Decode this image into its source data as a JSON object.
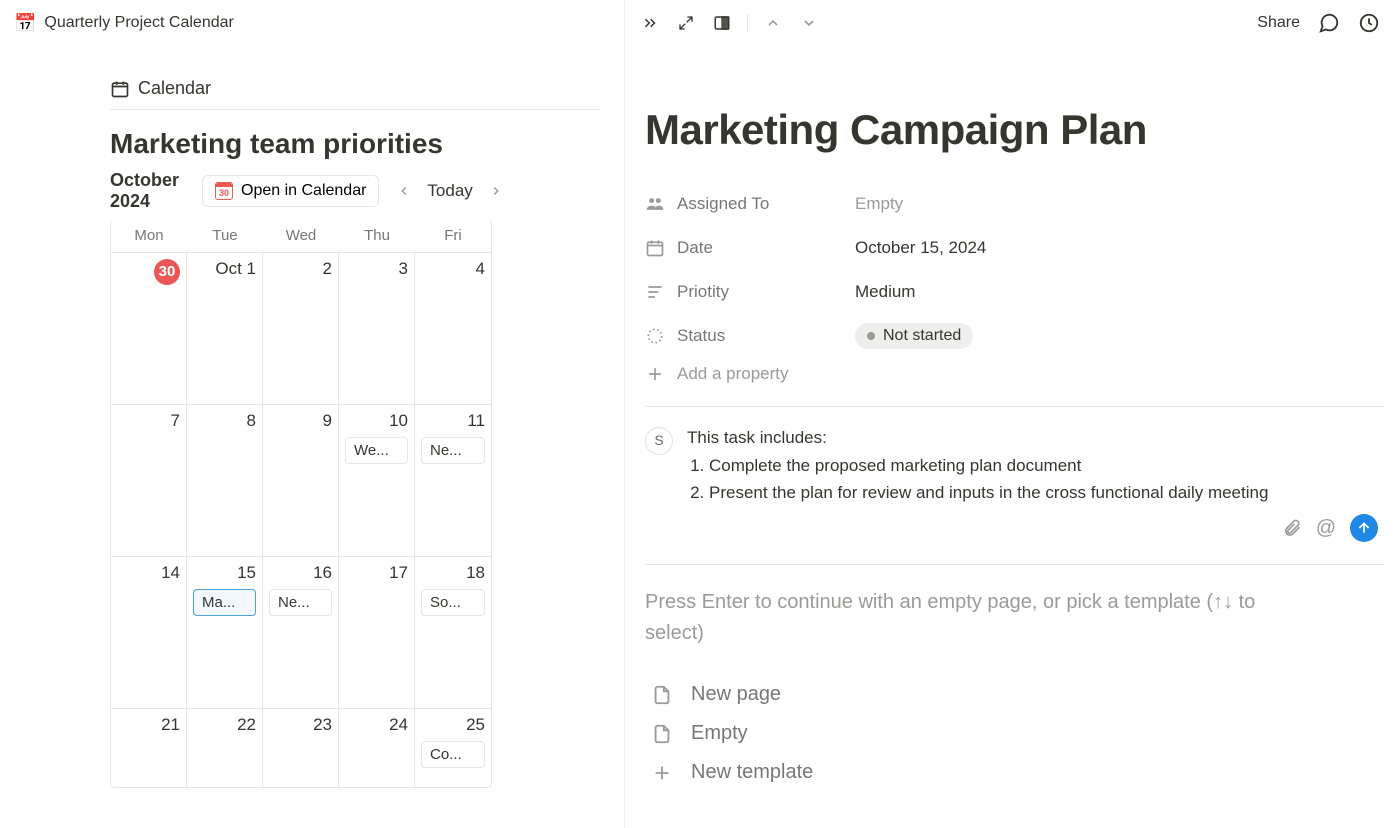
{
  "left": {
    "breadcrumb": "Quarterly Project Calendar",
    "view_label": "Calendar",
    "section_title": "Marketing team priorities",
    "month_line1": "October",
    "month_line2": "2024",
    "open_in_calendar": "Open in Calendar",
    "open_in_calendar_day": "30",
    "today": "Today",
    "dow": [
      "Mon",
      "Tue",
      "Wed",
      "Thu",
      "Fri"
    ],
    "weeks": [
      [
        {
          "num": "30",
          "prev": true
        },
        {
          "num": "Oct 1"
        },
        {
          "num": "2"
        },
        {
          "num": "3"
        },
        {
          "num": "4"
        }
      ],
      [
        {
          "num": "7"
        },
        {
          "num": "8"
        },
        {
          "num": "9"
        },
        {
          "num": "10",
          "event": "We..."
        },
        {
          "num": "11",
          "event": "Ne..."
        }
      ],
      [
        {
          "num": "14"
        },
        {
          "num": "15",
          "event": "Ma...",
          "selected": true
        },
        {
          "num": "16",
          "event": "Ne..."
        },
        {
          "num": "17"
        },
        {
          "num": "18",
          "event": "So..."
        }
      ],
      [
        {
          "num": "21"
        },
        {
          "num": "22"
        },
        {
          "num": "23"
        },
        {
          "num": "24"
        },
        {
          "num": "25",
          "event": "Co..."
        }
      ]
    ]
  },
  "right": {
    "share": "Share",
    "title": "Marketing Campaign Plan",
    "properties": {
      "assigned_label": "Assigned To",
      "assigned_value": "Empty",
      "date_label": "Date",
      "date_value": "October 15, 2024",
      "priority_label": "Priotity",
      "priority_value": "Medium",
      "status_label": "Status",
      "status_value": "Not started",
      "add_property": "Add a property"
    },
    "comment": {
      "avatar_letter": "S",
      "lead": "This task includes:",
      "item1": "Complete the proposed marketing plan document",
      "item2": "Present the plan for review and inputs in the cross functional daily meeting"
    },
    "placeholder_text": "Press Enter to continue with an empty page, or pick a template (↑↓ to select)",
    "templates": {
      "new_page": "New page",
      "empty": "Empty",
      "new_template": "New template"
    }
  }
}
